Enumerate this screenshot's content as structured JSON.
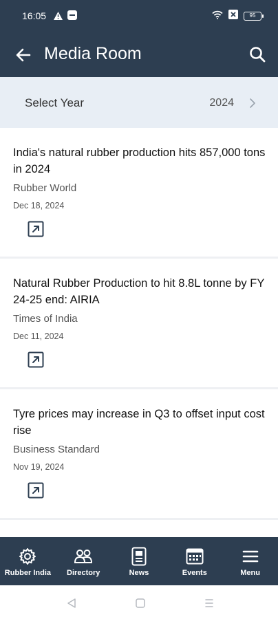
{
  "status_bar": {
    "time": "16:05",
    "battery": "95"
  },
  "app_bar": {
    "title": "Media Room"
  },
  "year_selector": {
    "label": "Select Year",
    "value": "2024"
  },
  "articles": [
    {
      "title": "India's natural rubber production hits 857,000 tons in 2024",
      "source": "Rubber World",
      "date": "Dec 18, 2024"
    },
    {
      "title": "Natural Rubber Production to hit 8.8L tonne by FY 24-25 end: AIRIA",
      "source": "Times of India",
      "date": "Dec 11, 2024"
    },
    {
      "title": "Tyre prices may increase in Q3 to offset input cost rise",
      "source": "Business Standard",
      "date": "Nov 19, 2024"
    }
  ],
  "bottom_nav": {
    "items": [
      {
        "label": "Rubber India",
        "icon": "gear-icon"
      },
      {
        "label": "Directory",
        "icon": "people-icon"
      },
      {
        "label": "News",
        "icon": "news-icon"
      },
      {
        "label": "Events",
        "icon": "events-icon"
      },
      {
        "label": "Menu",
        "icon": "menu-icon"
      }
    ]
  },
  "colors": {
    "primary": "#2d3e51",
    "year_bar_bg": "#e8eef5",
    "text": "#111111",
    "muted_text": "#555555"
  }
}
